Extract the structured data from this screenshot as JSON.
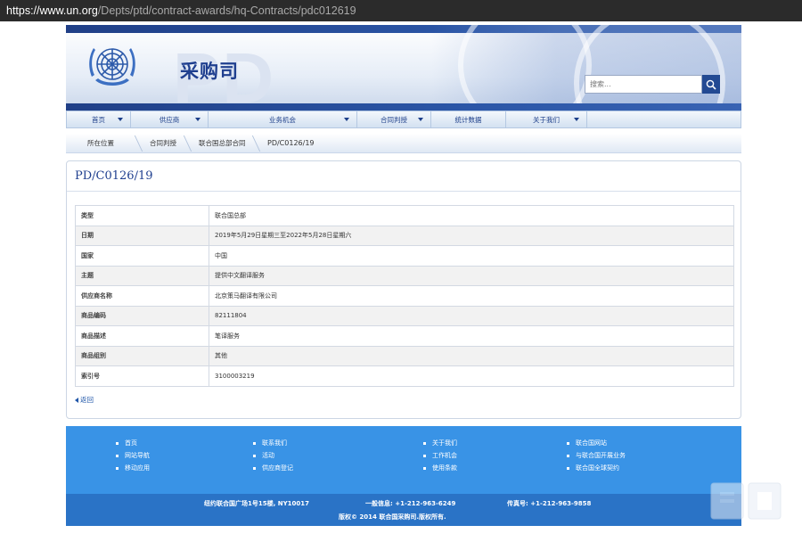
{
  "browser": {
    "url_host": "https://www.un.org",
    "url_path": "/Depts/ptd/contract-awards/hq-Contracts/pdc012619"
  },
  "header": {
    "site_title": "采购司",
    "big_letters": "PD",
    "search_placeholder": "搜索..."
  },
  "nav": [
    {
      "label": "首页",
      "dropdown": true
    },
    {
      "label": "供应商",
      "dropdown": true
    },
    {
      "label": "业务机会",
      "dropdown": true
    },
    {
      "label": "合同判授",
      "dropdown": true
    },
    {
      "label": "统计数据",
      "dropdown": false
    },
    {
      "label": "关于我们",
      "dropdown": true
    }
  ],
  "breadcrumb": [
    "所在位置",
    "合同判授",
    "联合国总部合同",
    "PD/C0126/19"
  ],
  "record": {
    "title": "PD/C0126/19",
    "rows": [
      {
        "key": "类型",
        "value": "联合国总部"
      },
      {
        "key": "日期",
        "value": "2019年5月29日星期三至2022年5月28日星期六"
      },
      {
        "key": "国家",
        "value": "中国"
      },
      {
        "key": "主题",
        "value": "提供中文翻译服务"
      },
      {
        "key": "供应商名称",
        "value": "北京策马翻译有限公司"
      },
      {
        "key": "商品编码",
        "value": "82111804"
      },
      {
        "key": "商品描述",
        "value": "笔译服务"
      },
      {
        "key": "商品组别",
        "value": "其他"
      },
      {
        "key": "索引号",
        "value": "3100003219"
      }
    ],
    "back_label": "返回"
  },
  "footer": {
    "columns": [
      [
        "首页",
        "网站导航",
        "移动应用"
      ],
      [
        "联系我们",
        "活动",
        "供应商登记"
      ],
      [
        "关于我们",
        "工作机会",
        "使用条款"
      ],
      [
        "联合国网站",
        "与联合国开展业务",
        "联合国全球契约"
      ]
    ],
    "address": "纽约联合国广场1号15楼, NY10017",
    "general_info": "一般信息: +1-212-963-6249",
    "fax": "传真号: +1-212-963-9858",
    "copyright": "版权© 2014 联合国采购司.版权所有."
  },
  "colors": {
    "brand_blue": "#1f3f8f",
    "footer_blue": "#3993e6",
    "footer_dark": "#2a73c6"
  }
}
